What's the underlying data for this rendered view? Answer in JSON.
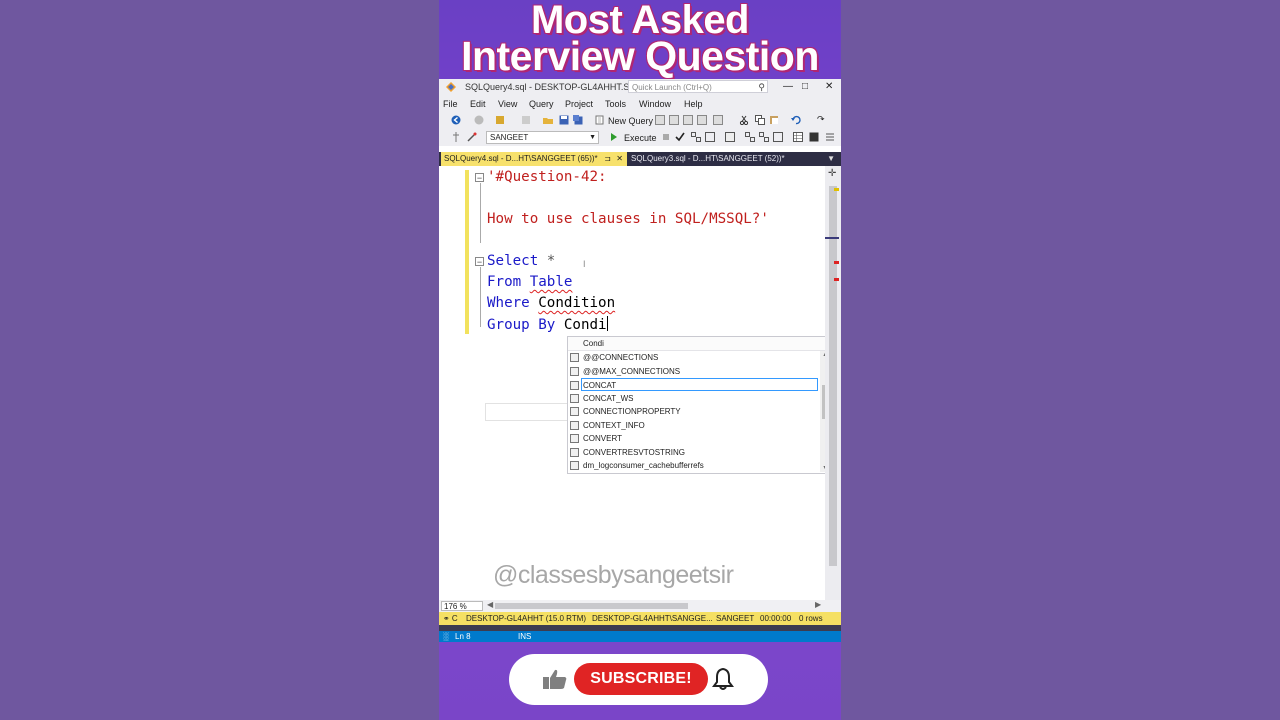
{
  "overlay": {
    "headline_line1": "Most Asked",
    "headline_line2": "Interview Question",
    "watermark": "@classesbysangeetsir",
    "subscribe_label": "SUBSCRIBE!"
  },
  "window": {
    "title": "SQLQuery4.sql - DESKTOP-GL4AHHT.SA...",
    "quick_launch_placeholder": "Quick Launch (Ctrl+Q)",
    "controls": {
      "minimize": "—",
      "maximize": "□",
      "close": "✕"
    }
  },
  "menu": [
    "File",
    "Edit",
    "View",
    "Query",
    "Project",
    "Tools",
    "Window",
    "Help"
  ],
  "toolbar": {
    "new_query_label": "New Query",
    "database": "SANGEET",
    "execute_label": "Execute"
  },
  "tabs": [
    {
      "label": "SQLQuery4.sql - D...HT\\SANGGEET (65))*",
      "close": "✕",
      "pin": "⊐"
    },
    {
      "label": "SQLQuery3.sql - D...HT\\SANGGEET (52))*"
    }
  ],
  "editor": {
    "line1": "'#Question-42:",
    "line3": "How to use clauses in SQL/MSSQL?'",
    "select_kw": "Select",
    "select_rest": " *",
    "from_kw": "From",
    "from_obj": "Table",
    "where_kw": "Where",
    "where_obj": "Condition",
    "group_kw": "Group By",
    "group_typed": "Condi"
  },
  "autocomplete": {
    "typed": "Condi",
    "items": [
      "@@CONNECTIONS",
      "@@MAX_CONNECTIONS",
      "CONCAT",
      "CONCAT_WS",
      "CONNECTIONPROPERTY",
      "CONTEXT_INFO",
      "CONVERT",
      "CONVERTRESVTOSTRING",
      "dm_logconsumer_cachebufferrefs"
    ],
    "selected_index": 2
  },
  "bottom": {
    "zoom": "176 %"
  },
  "status": {
    "connection": "DESKTOP-GL4AHHT (15.0 RTM)",
    "user": "DESKTOP-GL4AHHT\\SANGGE...",
    "database": "SANGEET",
    "elapsed": "00:00:00",
    "rows": "0 rows",
    "line": "Ln 8",
    "mode": "INS"
  },
  "colors": {
    "keyword": "#1a19c8",
    "string": "#c0201e",
    "status_bar": "#f5e063",
    "subscribe": "#e02424",
    "strip": "#7b3fd0",
    "background": "#6f579f"
  }
}
